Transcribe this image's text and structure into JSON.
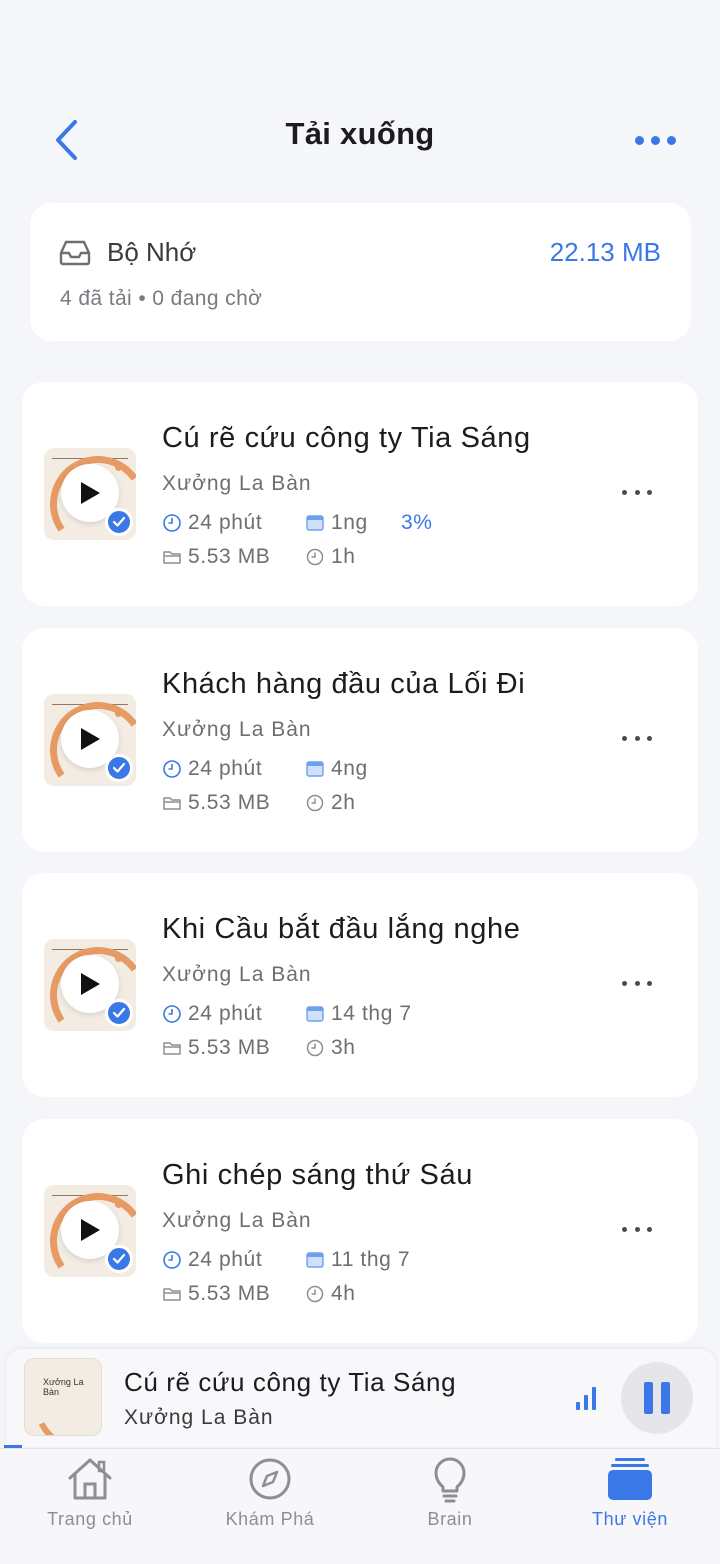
{
  "header": {
    "title": "Tải xuống"
  },
  "storage": {
    "title": "Bộ Nhớ",
    "size": "22.13 MB",
    "summary": "4 đã tải • 0 đang chờ"
  },
  "episodes": [
    {
      "title": "Cú rẽ cứu công ty Tia Sáng",
      "show": "Xưởng La Bàn",
      "duration": "24 phút",
      "date": "1ng",
      "progress": "3%",
      "size": "5.53 MB",
      "age": "1h"
    },
    {
      "title": "Khách hàng đầu của Lối Đi",
      "show": "Xưởng La Bàn",
      "duration": "24 phút",
      "date": "4ng",
      "progress": "",
      "size": "5.53 MB",
      "age": "2h"
    },
    {
      "title": "Khi Cầu bắt đầu lắng nghe",
      "show": "Xưởng La Bàn",
      "duration": "24 phút",
      "date": "14 thg 7",
      "progress": "",
      "size": "5.53 MB",
      "age": "3h"
    },
    {
      "title": "Ghi chép sáng thứ Sáu",
      "show": "Xưởng La Bàn",
      "duration": "24 phút",
      "date": "11 thg 7",
      "progress": "",
      "size": "5.53 MB",
      "age": "4h"
    }
  ],
  "mini_player": {
    "title": "Cú rẽ cứu công ty Tia Sáng",
    "show": "Xưởng La Bàn",
    "thumb_text": "Xưởng La Bàn",
    "progress_fraction": 0.03
  },
  "tabs": [
    {
      "label": "Trang chủ",
      "icon": "home-icon",
      "active": false
    },
    {
      "label": "Khám Phá",
      "icon": "compass-icon",
      "active": false
    },
    {
      "label": "Brain",
      "icon": "lightbulb-icon",
      "active": false
    },
    {
      "label": "Thư viện",
      "icon": "library-icon",
      "active": true
    }
  ],
  "colors": {
    "accent": "#3b78e7",
    "artwork_orange": "#e79a63"
  }
}
